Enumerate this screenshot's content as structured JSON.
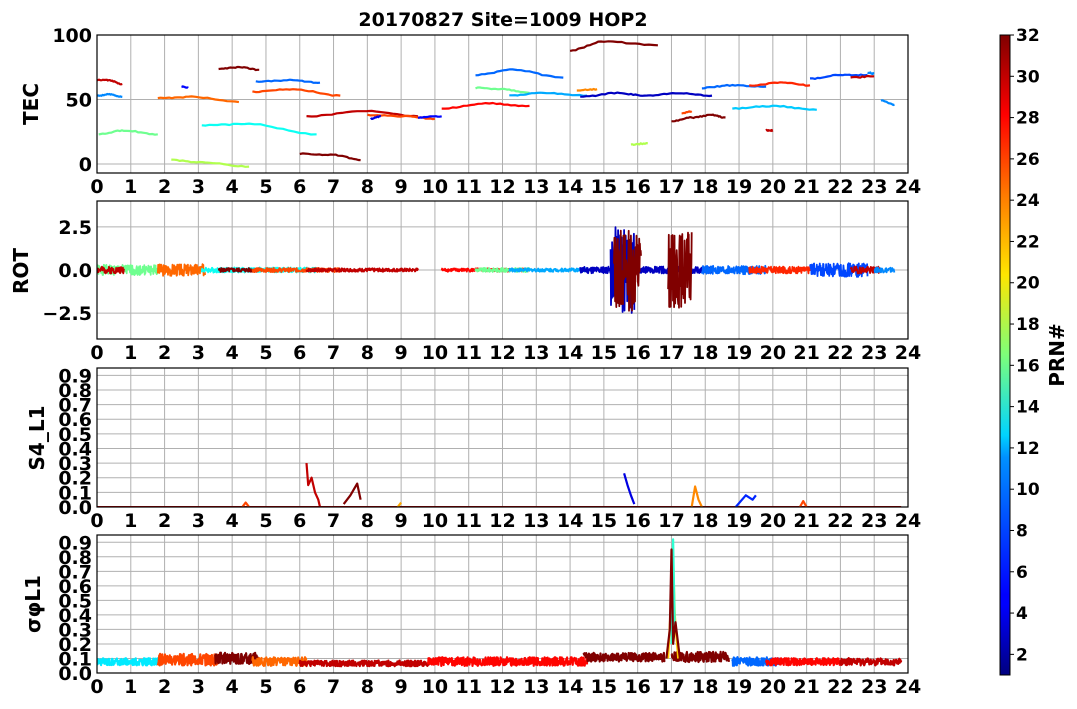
{
  "figure": {
    "title": "20170827 Site=1009 HOP2"
  },
  "colorbar": {
    "label": "PRN#",
    "range": [
      1,
      32
    ],
    "ticks": [
      2,
      4,
      6,
      8,
      10,
      12,
      14,
      16,
      18,
      20,
      22,
      24,
      26,
      28,
      30,
      32
    ],
    "colormap": "jet"
  },
  "chart_data": [
    {
      "type": "line",
      "ylabel": "TEC",
      "xlabel": "",
      "xlim": [
        0,
        24
      ],
      "ylim": [
        -7,
        100
      ],
      "xticks": [
        0,
        1,
        2,
        3,
        4,
        5,
        6,
        7,
        8,
        9,
        10,
        11,
        12,
        13,
        14,
        15,
        16,
        17,
        18,
        19,
        20,
        21,
        22,
        23,
        24
      ],
      "yticks": [
        0,
        50,
        100
      ],
      "ytick_labels": [
        "0",
        "50",
        "100"
      ],
      "grid": true,
      "series": [
        {
          "prn": 30,
          "x": [
            0.0,
            0.35,
            0.75
          ],
          "y": [
            65,
            65,
            62
          ]
        },
        {
          "prn": 9,
          "x": [
            0.0,
            0.4,
            0.75
          ],
          "y": [
            53,
            54,
            52
          ]
        },
        {
          "prn": 16,
          "x": [
            0.05,
            0.8,
            1.8
          ],
          "y": [
            23,
            26,
            23
          ]
        },
        {
          "prn": 25,
          "x": [
            1.8,
            2.8,
            4.2
          ],
          "y": [
            51,
            52,
            48
          ]
        },
        {
          "prn": 18,
          "x": [
            2.2,
            3.2,
            4.5
          ],
          "y": [
            3,
            1,
            -2
          ]
        },
        {
          "prn": 5,
          "x": [
            2.5,
            2.7
          ],
          "y": [
            60,
            59
          ]
        },
        {
          "prn": 13,
          "x": [
            3.1,
            4.5,
            6.5
          ],
          "y": [
            30,
            31,
            23
          ]
        },
        {
          "prn": 32,
          "x": [
            3.6,
            4.2,
            4.8
          ],
          "y": [
            74,
            75,
            73
          ]
        },
        {
          "prn": 8,
          "x": [
            4.7,
            5.8,
            6.6
          ],
          "y": [
            64,
            65,
            63
          ]
        },
        {
          "prn": 26,
          "x": [
            4.6,
            5.8,
            7.2
          ],
          "y": [
            56,
            58,
            53
          ]
        },
        {
          "prn": 32,
          "x": [
            6.0,
            7.0,
            7.8
          ],
          "y": [
            8,
            7,
            3
          ]
        },
        {
          "prn": 30,
          "x": [
            6.2,
            8.0,
            9.5
          ],
          "y": [
            37,
            41,
            37
          ]
        },
        {
          "prn": 26,
          "x": [
            8.0,
            9.2,
            10.0
          ],
          "y": [
            38,
            37,
            35
          ]
        },
        {
          "prn": 4,
          "x": [
            8.1,
            8.4
          ],
          "y": [
            35,
            37
          ]
        },
        {
          "prn": 5,
          "x": [
            9.5,
            10.2
          ],
          "y": [
            36,
            37
          ]
        },
        {
          "prn": 28,
          "x": [
            10.2,
            11.5,
            12.8
          ],
          "y": [
            43,
            47,
            45
          ]
        },
        {
          "prn": 8,
          "x": [
            11.2,
            12.3,
            13.8
          ],
          "y": [
            69,
            73,
            67
          ]
        },
        {
          "prn": 16,
          "x": [
            11.2,
            12.0,
            12.8
          ],
          "y": [
            59,
            58,
            55
          ]
        },
        {
          "prn": 10,
          "x": [
            12.2,
            13.2,
            14.5
          ],
          "y": [
            53,
            55,
            53
          ]
        },
        {
          "prn": 24,
          "x": [
            14.2,
            14.8
          ],
          "y": [
            57,
            58
          ]
        },
        {
          "prn": 32,
          "x": [
            14.0,
            15.0,
            16.6
          ],
          "y": [
            88,
            95,
            92
          ]
        },
        {
          "prn": 3,
          "x": [
            14.3,
            15.4,
            16.2,
            17.2,
            18.2
          ],
          "y": [
            52,
            55,
            53,
            55,
            53
          ]
        },
        {
          "prn": 18,
          "x": [
            15.8,
            16.3
          ],
          "y": [
            15,
            16
          ]
        },
        {
          "prn": 32,
          "x": [
            17.0,
            17.6,
            18.2,
            18.6
          ],
          "y": [
            33,
            36,
            38,
            36
          ]
        },
        {
          "prn": 26,
          "x": [
            17.3,
            17.6
          ],
          "y": [
            39,
            41
          ]
        },
        {
          "prn": 8,
          "x": [
            17.9,
            18.8,
            19.8
          ],
          "y": [
            59,
            61,
            60
          ]
        },
        {
          "prn": 11,
          "x": [
            18.8,
            20.0,
            21.3
          ],
          "y": [
            43,
            45,
            42
          ]
        },
        {
          "prn": 27,
          "x": [
            19.3,
            20.3,
            21.1
          ],
          "y": [
            61,
            63,
            61
          ]
        },
        {
          "prn": 30,
          "x": [
            19.8,
            20.0
          ],
          "y": [
            26,
            26
          ]
        },
        {
          "prn": 7,
          "x": [
            21.1,
            22.0,
            22.8
          ],
          "y": [
            66,
            69,
            69
          ]
        },
        {
          "prn": 30,
          "x": [
            22.3,
            23.0
          ],
          "y": [
            67,
            68
          ]
        },
        {
          "prn": 9,
          "x": [
            22.8,
            23.0
          ],
          "y": [
            71,
            70
          ]
        },
        {
          "prn": 9,
          "x": [
            23.2,
            23.6
          ],
          "y": [
            49,
            46
          ]
        }
      ]
    },
    {
      "type": "line",
      "ylabel": "ROT",
      "xlabel": "",
      "xlim": [
        0,
        24
      ],
      "ylim": [
        -4,
        4
      ],
      "xticks": [
        0,
        1,
        2,
        3,
        4,
        5,
        6,
        7,
        8,
        9,
        10,
        11,
        12,
        13,
        14,
        15,
        16,
        17,
        18,
        19,
        20,
        21,
        22,
        23,
        24
      ],
      "yticks": [
        -2.5,
        0.0,
        2.5
      ],
      "ytick_labels": [
        "−2.5",
        "0.0",
        "2.5"
      ],
      "grid": true,
      "series": [
        {
          "prn": 16,
          "x": [
            0.0,
            1.8
          ],
          "amp": 0.3,
          "seed": 1
        },
        {
          "prn": 30,
          "x": [
            0.0,
            0.8
          ],
          "amp": 0.2,
          "seed": 2
        },
        {
          "prn": 25,
          "x": [
            1.8,
            3.2
          ],
          "amp": 0.35,
          "seed": 3
        },
        {
          "prn": 13,
          "x": [
            3.1,
            6.5
          ],
          "amp": 0.15,
          "seed": 4
        },
        {
          "prn": 32,
          "x": [
            3.6,
            4.8
          ],
          "amp": 0.12,
          "seed": 5
        },
        {
          "prn": 26,
          "x": [
            4.6,
            7.2
          ],
          "amp": 0.12,
          "seed": 6
        },
        {
          "prn": 30,
          "x": [
            6.2,
            9.5
          ],
          "amp": 0.1,
          "seed": 7
        },
        {
          "prn": 28,
          "x": [
            10.2,
            12.8
          ],
          "amp": 0.1,
          "seed": 8
        },
        {
          "prn": 16,
          "x": [
            11.2,
            12.8
          ],
          "amp": 0.12,
          "seed": 9
        },
        {
          "prn": 10,
          "x": [
            12.2,
            14.5
          ],
          "amp": 0.1,
          "seed": 10
        },
        {
          "prn": 3,
          "x": [
            14.3,
            16.2
          ],
          "amp": 0.2,
          "seed": 11
        },
        {
          "prn": 3,
          "x": [
            15.2,
            15.9
          ],
          "amp": 2.5,
          "seed": 12
        },
        {
          "prn": 32,
          "x": [
            15.3,
            16.1
          ],
          "amp": 2.4,
          "seed": 13
        },
        {
          "prn": 3,
          "x": [
            16.2,
            18.2
          ],
          "amp": 0.2,
          "seed": 14
        },
        {
          "prn": 32,
          "x": [
            16.9,
            17.6
          ],
          "amp": 2.2,
          "seed": 15
        },
        {
          "prn": 8,
          "x": [
            17.9,
            19.8
          ],
          "amp": 0.25,
          "seed": 16
        },
        {
          "prn": 27,
          "x": [
            19.3,
            21.1
          ],
          "amp": 0.2,
          "seed": 17
        },
        {
          "prn": 7,
          "x": [
            21.1,
            22.8
          ],
          "amp": 0.4,
          "seed": 18
        },
        {
          "prn": 30,
          "x": [
            22.3,
            23.2
          ],
          "amp": 0.2,
          "seed": 19
        },
        {
          "prn": 9,
          "x": [
            23.0,
            23.6
          ],
          "amp": 0.15,
          "seed": 20
        }
      ]
    },
    {
      "type": "line",
      "ylabel": "S4_L1",
      "xlabel": "",
      "xlim": [
        0,
        24
      ],
      "ylim": [
        0,
        0.95
      ],
      "xticks": [
        0,
        1,
        2,
        3,
        4,
        5,
        6,
        7,
        8,
        9,
        10,
        11,
        12,
        13,
        14,
        15,
        16,
        17,
        18,
        19,
        20,
        21,
        22,
        23,
        24
      ],
      "yticks": [
        0.0,
        0.1,
        0.2,
        0.3,
        0.4,
        0.5,
        0.6,
        0.7,
        0.8,
        0.9
      ],
      "ytick_labels": [
        "0.0",
        "0.1",
        "0.2",
        "0.3",
        "0.4",
        "0.5",
        "0.6",
        "0.7",
        "0.8",
        "0.9"
      ],
      "grid": true,
      "baseline": {
        "prn": 30,
        "x": [
          0.0,
          23.8
        ],
        "y": 0.0
      },
      "series": [
        {
          "prn": 26,
          "x": [
            4.3,
            4.4,
            4.5
          ],
          "y": [
            0.0,
            0.03,
            0.0
          ]
        },
        {
          "prn": 30,
          "x": [
            6.2,
            6.25,
            6.35,
            6.45,
            6.55,
            6.6
          ],
          "y": [
            0.3,
            0.15,
            0.2,
            0.1,
            0.05,
            0.0
          ]
        },
        {
          "prn": 32,
          "x": [
            7.3,
            7.5,
            7.6,
            7.7,
            7.8
          ],
          "y": [
            0.02,
            0.08,
            0.12,
            0.16,
            0.05
          ]
        },
        {
          "prn": 23,
          "x": [
            8.9,
            9.0
          ],
          "y": [
            0.0,
            0.03
          ]
        },
        {
          "prn": 4,
          "x": [
            15.6,
            15.7,
            15.8,
            15.9
          ],
          "y": [
            0.23,
            0.15,
            0.08,
            0.02
          ]
        },
        {
          "prn": 24,
          "x": [
            17.6,
            17.7,
            17.8,
            17.9
          ],
          "y": [
            0.0,
            0.14,
            0.05,
            0.0
          ]
        },
        {
          "prn": 6,
          "x": [
            18.9,
            19.2,
            19.4,
            19.5
          ],
          "y": [
            0.0,
            0.08,
            0.05,
            0.08
          ]
        },
        {
          "prn": 26,
          "x": [
            20.8,
            20.9,
            21.0
          ],
          "y": [
            0.0,
            0.04,
            0.0
          ]
        }
      ]
    },
    {
      "type": "line",
      "ylabel": "σφL1",
      "xlabel": "",
      "xlim": [
        0,
        24
      ],
      "ylim": [
        0,
        0.95
      ],
      "xticks": [
        0,
        1,
        2,
        3,
        4,
        5,
        6,
        7,
        8,
        9,
        10,
        11,
        12,
        13,
        14,
        15,
        16,
        17,
        18,
        19,
        20,
        21,
        22,
        23,
        24
      ],
      "yticks": [
        0.0,
        0.1,
        0.2,
        0.3,
        0.4,
        0.5,
        0.6,
        0.7,
        0.8,
        0.9
      ],
      "ytick_labels": [
        "0.0",
        "0.1",
        "0.2",
        "0.3",
        "0.4",
        "0.5",
        "0.6",
        "0.7",
        "0.8",
        "0.9"
      ],
      "grid": true,
      "series": [
        {
          "prn": 12,
          "x": [
            0.0,
            1.8
          ],
          "base": 0.07,
          "amp": 0.05,
          "seed": 31
        },
        {
          "prn": 26,
          "x": [
            1.8,
            3.6
          ],
          "base": 0.08,
          "amp": 0.08,
          "seed": 32
        },
        {
          "prn": 32,
          "x": [
            3.5,
            4.8
          ],
          "base": 0.09,
          "amp": 0.08,
          "seed": 33
        },
        {
          "prn": 25,
          "x": [
            4.6,
            6.2
          ],
          "base": 0.07,
          "amp": 0.06,
          "seed": 34
        },
        {
          "prn": 30,
          "x": [
            6.0,
            9.8
          ],
          "base": 0.06,
          "amp": 0.04,
          "seed": 35
        },
        {
          "prn": 28,
          "x": [
            9.8,
            14.5
          ],
          "base": 0.07,
          "amp": 0.06,
          "seed": 36
        },
        {
          "prn": 32,
          "x": [
            14.4,
            16.8
          ],
          "base": 0.1,
          "amp": 0.06,
          "seed": 37
        },
        {
          "prn": 32,
          "x": [
            17.0,
            18.7
          ],
          "base": 0.1,
          "amp": 0.07,
          "seed": 38
        },
        {
          "prn": 8,
          "x": [
            18.8,
            20.2
          ],
          "base": 0.07,
          "amp": 0.06,
          "seed": 39
        },
        {
          "prn": 28,
          "x": [
            19.8,
            22.0
          ],
          "base": 0.07,
          "amp": 0.05,
          "seed": 40
        },
        {
          "prn": 30,
          "x": [
            22.0,
            23.8
          ],
          "base": 0.07,
          "amp": 0.05,
          "seed": 41
        },
        {
          "prn": 22,
          "x": [
            16.9,
            17.0,
            17.05,
            17.1,
            17.2
          ],
          "y": [
            0.1,
            0.55,
            0.8,
            0.4,
            0.1
          ]
        },
        {
          "prn": 14,
          "x": [
            17.0,
            17.05,
            17.1
          ],
          "y": [
            0.2,
            0.92,
            0.3
          ]
        },
        {
          "prn": 32,
          "x": [
            16.85,
            16.95,
            17.0,
            17.05,
            17.12,
            17.25
          ],
          "y": [
            0.1,
            0.3,
            0.85,
            0.2,
            0.35,
            0.1
          ]
        }
      ]
    }
  ]
}
